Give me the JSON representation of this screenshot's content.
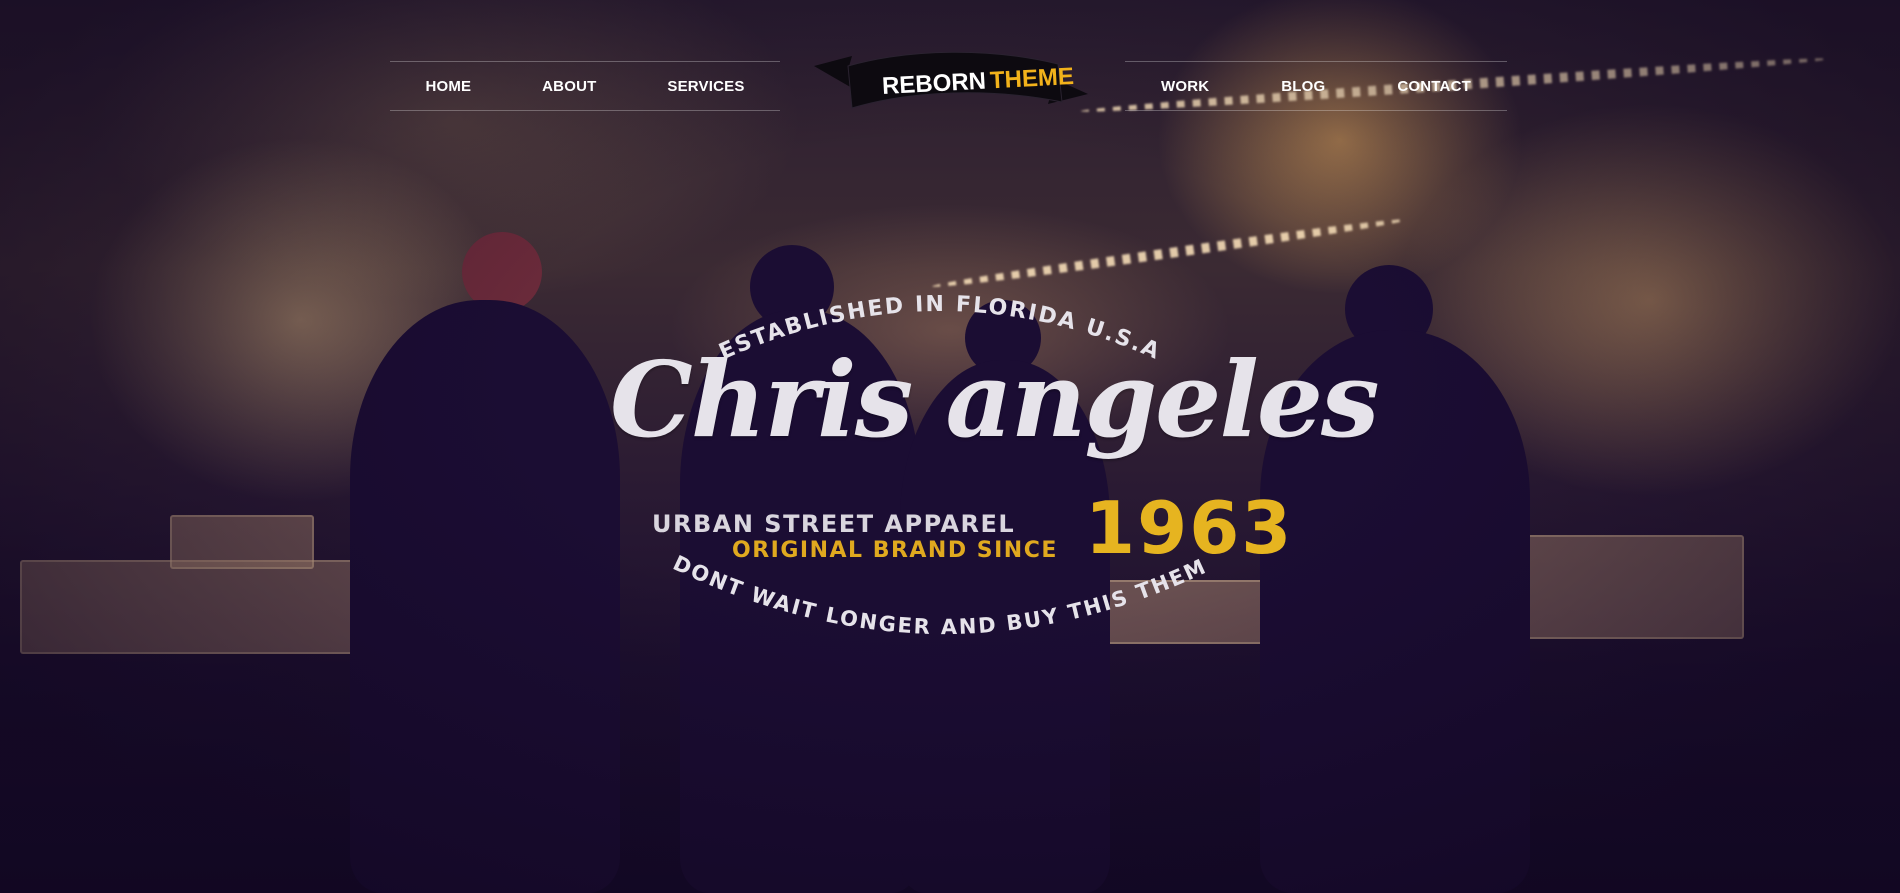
{
  "nav": {
    "left": [
      {
        "label": "HOME"
      },
      {
        "label": "ABOUT"
      },
      {
        "label": "SERVICES"
      }
    ],
    "right": [
      {
        "label": "WORK"
      },
      {
        "label": "BLOG"
      },
      {
        "label": "CONTACT"
      }
    ]
  },
  "logo": {
    "part1": "REBORN",
    "part2": "THEME",
    "colors": {
      "part1": "#ffffff",
      "part2": "#f2b21b",
      "ribbon": "#0d0a10"
    }
  },
  "hero": {
    "arc_top": "- ESTABLISHED IN FLORIDA U.S.A -",
    "title": "Chris angeles",
    "tagline": "URBAN STREET APPAREL",
    "subtagline": "ORIGINAL BRAND SINCE",
    "year": "1963",
    "arc_bottom": "-DONT WAIT LONGER AND BUY THIS THEME-",
    "colors": {
      "light": "#e6e3ea",
      "accent": "#e6b420"
    }
  }
}
